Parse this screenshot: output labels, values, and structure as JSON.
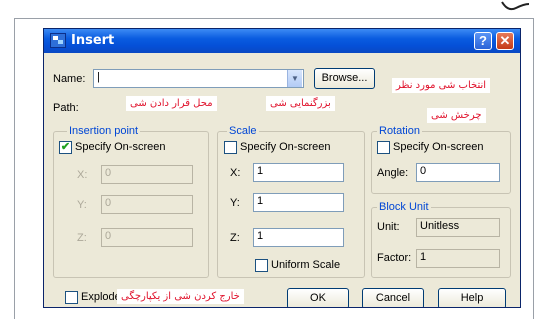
{
  "window": {
    "title": "Insert",
    "help_glyph": "?",
    "close_glyph": "✕"
  },
  "name": {
    "label": "Name:",
    "value": "|",
    "browse": "Browse..."
  },
  "path": {
    "label": "Path:"
  },
  "insertion": {
    "title": "Insertion point",
    "specify": "Specify On-screen",
    "specify_checked": true,
    "x_label": "X:",
    "x": "0",
    "y_label": "Y:",
    "y": "0",
    "z_label": "Z:",
    "z": "0"
  },
  "scale": {
    "title": "Scale",
    "specify": "Specify On-screen",
    "specify_checked": false,
    "x_label": "X:",
    "x": "1",
    "y_label": "Y:",
    "y": "1",
    "z_label": "Z:",
    "z": "1",
    "uniform": "Uniform Scale",
    "uniform_checked": false
  },
  "rotation": {
    "title": "Rotation",
    "specify": "Specify On-screen",
    "specify_checked": false,
    "angle_label": "Angle:",
    "angle": "0"
  },
  "block_unit": {
    "title": "Block Unit",
    "unit_label": "Unit:",
    "unit": "Unitless",
    "factor_label": "Factor:",
    "factor": "1"
  },
  "explode": {
    "label": "Explode",
    "checked": false
  },
  "buttons": {
    "ok": "OK",
    "cancel": "Cancel",
    "help": "Help"
  },
  "annotations": {
    "select_object": "انتخاب شی مورد نظر",
    "rotate_object": "چرخش شی",
    "insertion_place": "محل قرار دادن شی",
    "scale_object": "بزرگنمایی شی",
    "explode_object": "خارج کردن شی از یکپارچگی"
  },
  "colors": {
    "title_bar": "#0a5ce0",
    "dialog_bg": "#ece9d8",
    "group_title": "#0046d5",
    "annotation": "#e0102a"
  }
}
